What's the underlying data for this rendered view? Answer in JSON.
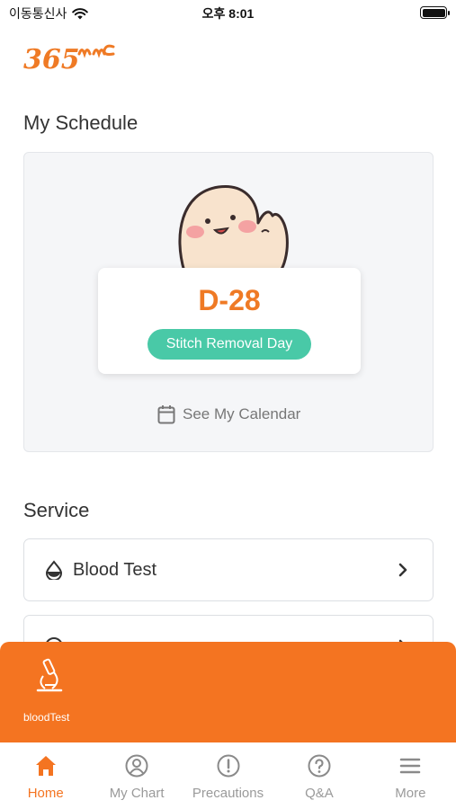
{
  "status_bar": {
    "carrier": "이동통신사",
    "time": "오후 8:01",
    "battery_level": 1.0
  },
  "logo": {
    "text": "365mc",
    "color": "#ef7a25"
  },
  "schedule": {
    "title": "My Schedule",
    "dday": "D-28",
    "event": "Stitch Removal Day",
    "calendar_link": "See My Calendar"
  },
  "service": {
    "title": "Service",
    "items": [
      {
        "label": "Blood Test",
        "icon": "drop-icon"
      },
      {
        "label": "",
        "icon": "info-icon"
      }
    ]
  },
  "popup": {
    "label": "bloodTest",
    "icon": "microscope-icon"
  },
  "tabs": [
    {
      "label": "Home",
      "icon": "home-icon",
      "active": true
    },
    {
      "label": "My Chart",
      "icon": "user-circle-icon",
      "active": false
    },
    {
      "label": "Precautions",
      "icon": "exclamation-circle-icon",
      "active": false
    },
    {
      "label": "Q&A",
      "icon": "question-circle-icon",
      "active": false
    },
    {
      "label": "More",
      "icon": "menu-icon",
      "active": false
    }
  ],
  "colors": {
    "accent": "#f47421",
    "dday": "#ef7a25",
    "pill": "#49c9a7",
    "inactive": "#9a9a9a"
  }
}
